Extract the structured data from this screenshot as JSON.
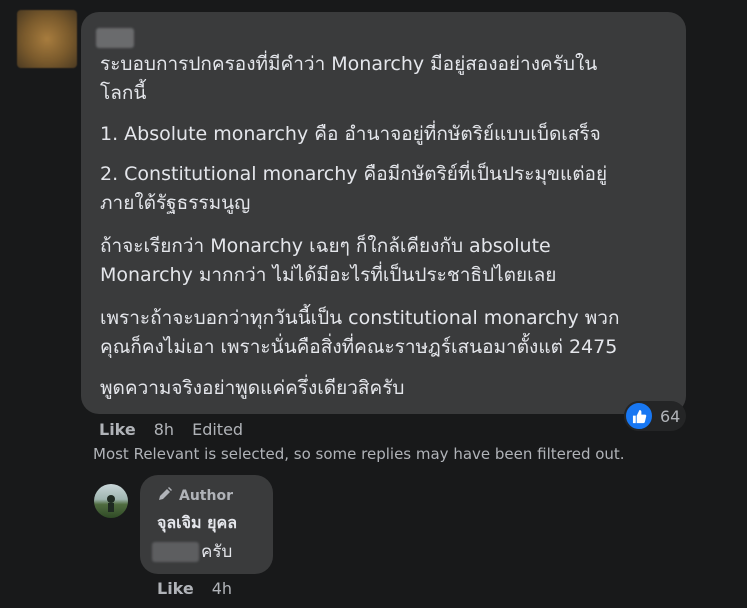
{
  "comment": {
    "paragraphs": [
      "ระบอบการปกครองที่มีคำว่า Monarchy มีอยู่สองอย่างครับใน\nโลกนี้",
      "1. Absolute monarchy คือ อำนาจอยู่ที่กษัตริย์แบบเบ็ดเสร็จ",
      "2. Constitutional monarchy คือมีกษัตริย์ที่เป็นประมุขแต่อยู่\nภายใต้รัฐธรรมนูญ",
      "ถ้าจะเรียกว่า Monarchy เฉยๆ ก็ใกล้เคียงกับ absolute\nMonarchy มากกว่า ไม่ได้มีอะไรที่เป็นประชาธิปไตยเลย",
      "เพราะถ้าจะบอกว่าทุกวันนี้เป็น constitutional monarchy พวก\nคุณก็คงไม่เอา เพราะนั่นคือสิ่งที่คณะราษฎร์เสนอมาตั้งแต่ 2475",
      "พูดความจริงอย่าพูดแค่ครึ่งเดียวสิครับ"
    ],
    "reaction_count": "64",
    "actions": {
      "like": "Like",
      "time": "8h",
      "edited": "Edited"
    }
  },
  "filter_note": "Most Relevant is selected, so some replies may have been filtered out.",
  "reply": {
    "author_tag": "Author",
    "name": "จุลเจิม ยุคล",
    "text": "ครับ",
    "actions": {
      "like": "Like",
      "time": "4h"
    }
  },
  "colors": {
    "background": "#18191a",
    "bubble": "#3a3b3c",
    "text": "#e4e6eb",
    "secondary_text": "#b0b3b8",
    "like_blue": "#1877f2"
  },
  "icons": {
    "reaction": "like-thumb-icon",
    "author": "pencil-icon"
  }
}
